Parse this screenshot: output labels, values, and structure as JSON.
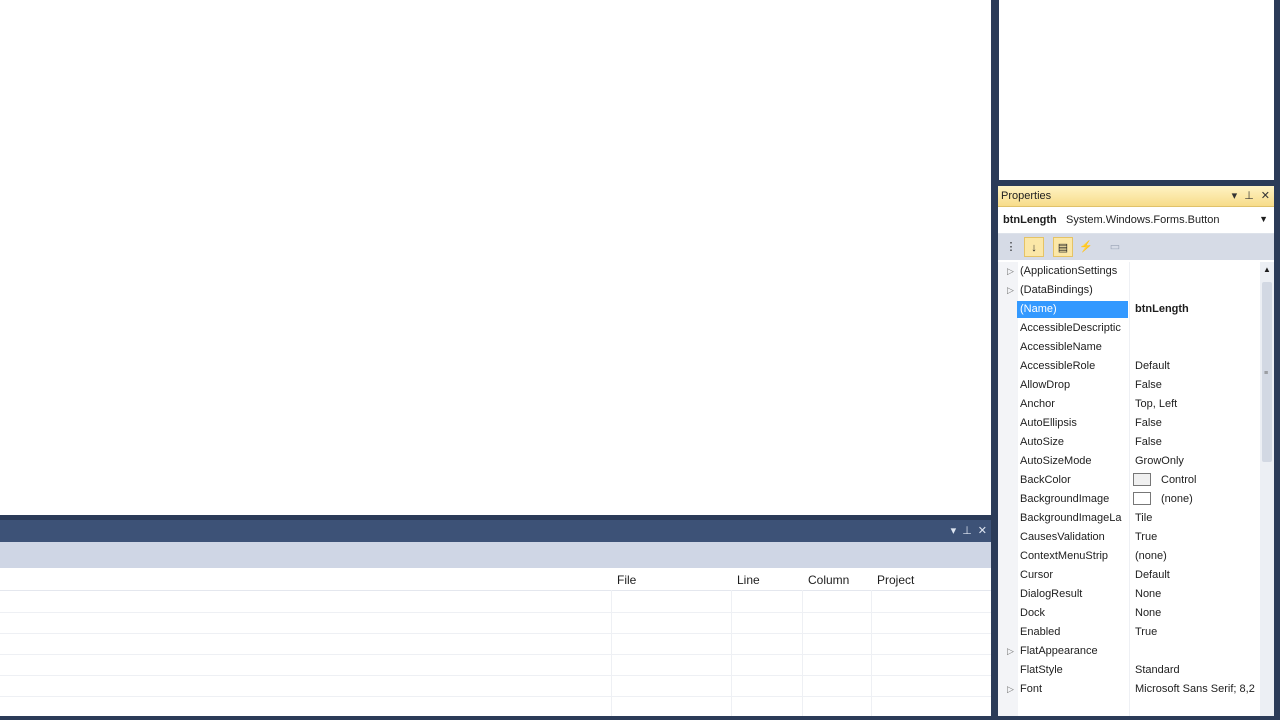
{
  "error_list": {
    "columns": [
      "File",
      "Line",
      "Column",
      "Project"
    ]
  },
  "properties": {
    "title": "Properties",
    "object_name": "btnLength",
    "object_type": "System.Windows.Forms.Button",
    "rows": [
      {
        "name": "(ApplicationSettings",
        "value": "",
        "expand": "▷"
      },
      {
        "name": "(DataBindings)",
        "value": "",
        "expand": "▷"
      },
      {
        "name": "(Name)",
        "value": "btnLength",
        "expand": ""
      },
      {
        "name": "AccessibleDescriptic",
        "value": "",
        "expand": ""
      },
      {
        "name": "AccessibleName",
        "value": "",
        "expand": ""
      },
      {
        "name": "AccessibleRole",
        "value": "Default",
        "expand": ""
      },
      {
        "name": "AllowDrop",
        "value": "False",
        "expand": ""
      },
      {
        "name": "Anchor",
        "value": "Top, Left",
        "expand": ""
      },
      {
        "name": "AutoEllipsis",
        "value": "False",
        "expand": ""
      },
      {
        "name": "AutoSize",
        "value": "False",
        "expand": ""
      },
      {
        "name": "AutoSizeMode",
        "value": "GrowOnly",
        "expand": ""
      },
      {
        "name": "BackColor",
        "value": "Control",
        "expand": ""
      },
      {
        "name": "BackgroundImage",
        "value": "(none)",
        "expand": ""
      },
      {
        "name": "BackgroundImageLa",
        "value": "Tile",
        "expand": ""
      },
      {
        "name": "CausesValidation",
        "value": "True",
        "expand": ""
      },
      {
        "name": "ContextMenuStrip",
        "value": "(none)",
        "expand": ""
      },
      {
        "name": "Cursor",
        "value": "Default",
        "expand": ""
      },
      {
        "name": "DialogResult",
        "value": "None",
        "expand": ""
      },
      {
        "name": "Dock",
        "value": "None",
        "expand": ""
      },
      {
        "name": "Enabled",
        "value": "True",
        "expand": ""
      },
      {
        "name": "FlatAppearance",
        "value": "",
        "expand": "▷"
      },
      {
        "name": "FlatStyle",
        "value": "Standard",
        "expand": ""
      },
      {
        "name": "Font",
        "value": "Microsoft Sans Serif; 8,2",
        "expand": "▷"
      }
    ]
  },
  "colors": {
    "frame": "#2b3b58",
    "selection": "#3399ff",
    "title_active": "#f7dc8a"
  }
}
